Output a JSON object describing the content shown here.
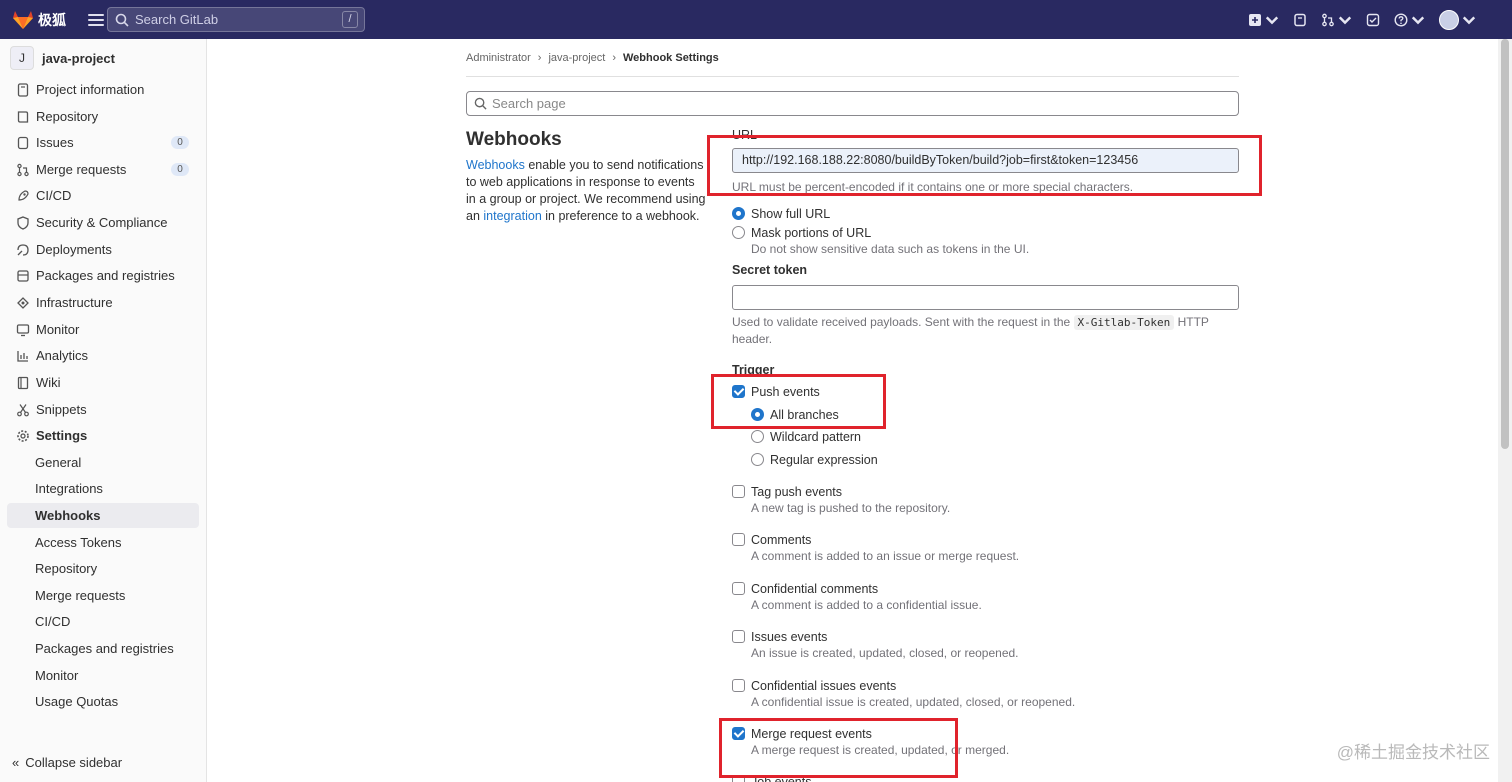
{
  "topbar": {
    "logo_text": "极狐",
    "search_placeholder": "Search GitLab",
    "search_shortcut": "/",
    "icons": [
      "plus-icon",
      "issues-icon",
      "merge-request-icon",
      "todo-icon",
      "help-icon",
      "avatar"
    ]
  },
  "sidebar": {
    "project_initial": "J",
    "project_name": "java-project",
    "items": [
      {
        "label": "Project information",
        "icon": "info-icon"
      },
      {
        "label": "Repository",
        "icon": "book-icon"
      },
      {
        "label": "Issues",
        "icon": "issues-icon",
        "badge": "0"
      },
      {
        "label": "Merge requests",
        "icon": "merge-request-icon",
        "badge": "0"
      },
      {
        "label": "CI/CD",
        "icon": "rocket-icon"
      },
      {
        "label": "Security & Compliance",
        "icon": "shield-icon"
      },
      {
        "label": "Deployments",
        "icon": "deployments-icon"
      },
      {
        "label": "Packages and registries",
        "icon": "package-icon"
      },
      {
        "label": "Infrastructure",
        "icon": "cloud-icon"
      },
      {
        "label": "Monitor",
        "icon": "monitor-icon"
      },
      {
        "label": "Analytics",
        "icon": "chart-icon"
      },
      {
        "label": "Wiki",
        "icon": "wiki-icon"
      },
      {
        "label": "Snippets",
        "icon": "snippet-icon"
      },
      {
        "label": "Settings",
        "icon": "gear-icon"
      }
    ],
    "settings_sub": [
      "General",
      "Integrations",
      "Webhooks",
      "Access Tokens",
      "Repository",
      "Merge requests",
      "CI/CD",
      "Packages and registries",
      "Monitor",
      "Usage Quotas"
    ],
    "active_sub": "Webhooks",
    "collapse_label": "Collapse sidebar"
  },
  "breadcrumb": [
    "Administrator",
    "java-project",
    "Webhook Settings"
  ],
  "page_search_placeholder": "Search page",
  "webhooks": {
    "title": "Webhooks",
    "desc_link1": "Webhooks",
    "desc_part1": " enable you to send notifications to web applications in response to events in a group or project. We recommend using an ",
    "desc_link2": "integration",
    "desc_part2": " in preference to a webhook."
  },
  "form": {
    "url_label": "URL",
    "url_value": "http://192.168.188.22:8080/buildByToken/build?job=first&token=123456",
    "url_help": "URL must be percent-encoded if it contains one or more special characters.",
    "show_full_url": "Show full URL",
    "mask_url": "Mask portions of URL",
    "mask_url_help": "Do not show sensitive data such as tokens in the UI.",
    "secret_label": "Secret token",
    "secret_value": "",
    "secret_help_1": "Used to validate received payloads. Sent with the request in the ",
    "secret_help_code": "X-Gitlab-Token",
    "secret_help_2": " HTTP header.",
    "trigger_label": "Trigger",
    "push_events": "Push events",
    "all_branches": "All branches",
    "wildcard": "Wildcard pattern",
    "regex": "Regular expression",
    "events": [
      {
        "title": "Tag push events",
        "sub": "A new tag is pushed to the repository.",
        "checked": false
      },
      {
        "title": "Comments",
        "sub": "A comment is added to an issue or merge request.",
        "checked": false
      },
      {
        "title": "Confidential comments",
        "sub": "A comment is added to a confidential issue.",
        "checked": false
      },
      {
        "title": "Issues events",
        "sub": "An issue is created, updated, closed, or reopened.",
        "checked": false
      },
      {
        "title": "Confidential issues events",
        "sub": "A confidential issue is created, updated, closed, or reopened.",
        "checked": false
      },
      {
        "title": "Merge request events",
        "sub": "A merge request is created, updated, or merged.",
        "checked": true
      },
      {
        "title": "Job events",
        "sub": "",
        "checked": false
      }
    ]
  },
  "watermark": "@稀土掘金技术社区",
  "colors": {
    "topbar": "#292961",
    "accent": "#1f75cb",
    "highlight": "#e0232c"
  }
}
